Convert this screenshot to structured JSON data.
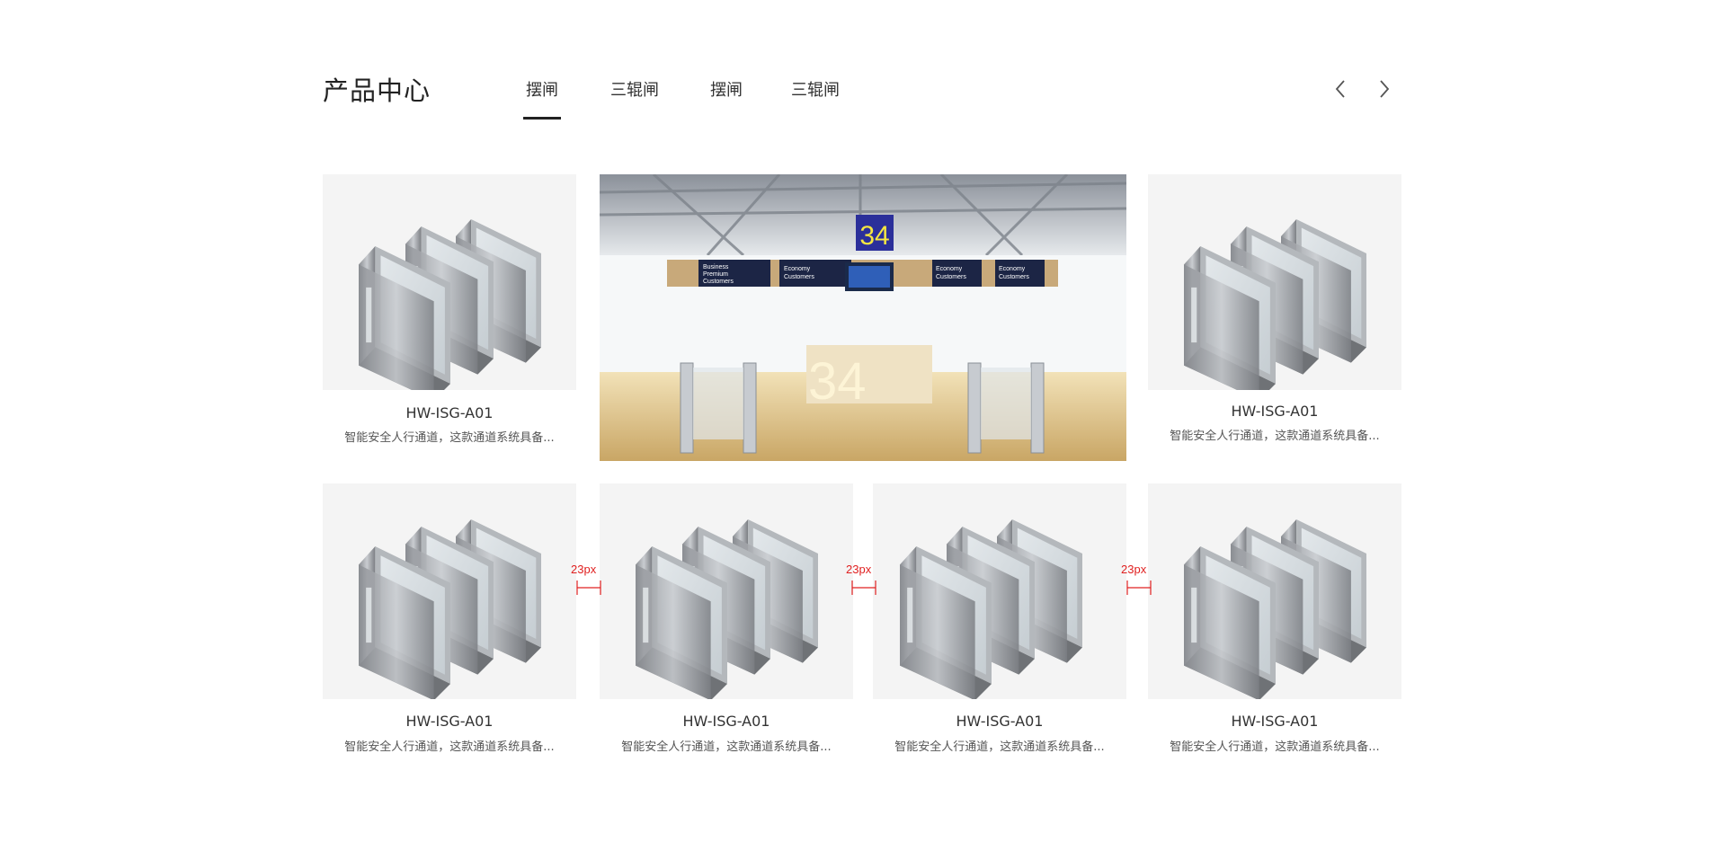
{
  "header": {
    "title": "产品中心",
    "tabs": [
      {
        "label": "摆闸",
        "active": true
      },
      {
        "label": "三辊闸",
        "active": false
      },
      {
        "label": "摆闸",
        "active": false
      },
      {
        "label": "三辊闸",
        "active": false
      }
    ],
    "prev_icon": "chevron-left-icon",
    "next_icon": "chevron-right-icon"
  },
  "feature_image": {
    "gate_number": "34",
    "signs": [
      {
        "line1": "Business",
        "line2": "Premium",
        "line3": "Customers"
      },
      {
        "line1": "Economy",
        "line2": "Customers"
      },
      {
        "line1": "Economy",
        "line2": "Customers"
      },
      {
        "line1": "Economy",
        "line2": "Customers"
      }
    ],
    "desk_number": "34"
  },
  "products": [
    {
      "title": "HW-ISG-A01",
      "desc": "智能安全人行通道，这款通道系统具备..."
    },
    {
      "title": "HW-ISG-A01",
      "desc": "智能安全人行通道，这款通道系统具备..."
    },
    {
      "title": "HW-ISG-A01",
      "desc": "智能安全人行通道，这款通道系统具备..."
    },
    {
      "title": "HW-ISG-A01",
      "desc": "智能安全人行通道，这款通道系统具备..."
    },
    {
      "title": "HW-ISG-A01",
      "desc": "智能安全人行通道，这款通道系统具备..."
    },
    {
      "title": "HW-ISG-A01",
      "desc": "智能安全人行通道，这款通道系统具备..."
    }
  ],
  "annotations": {
    "gap_label": "23px"
  },
  "colors": {
    "accent": "#222222",
    "annotation": "#e02020",
    "card_bg": "#f4f4f4"
  }
}
